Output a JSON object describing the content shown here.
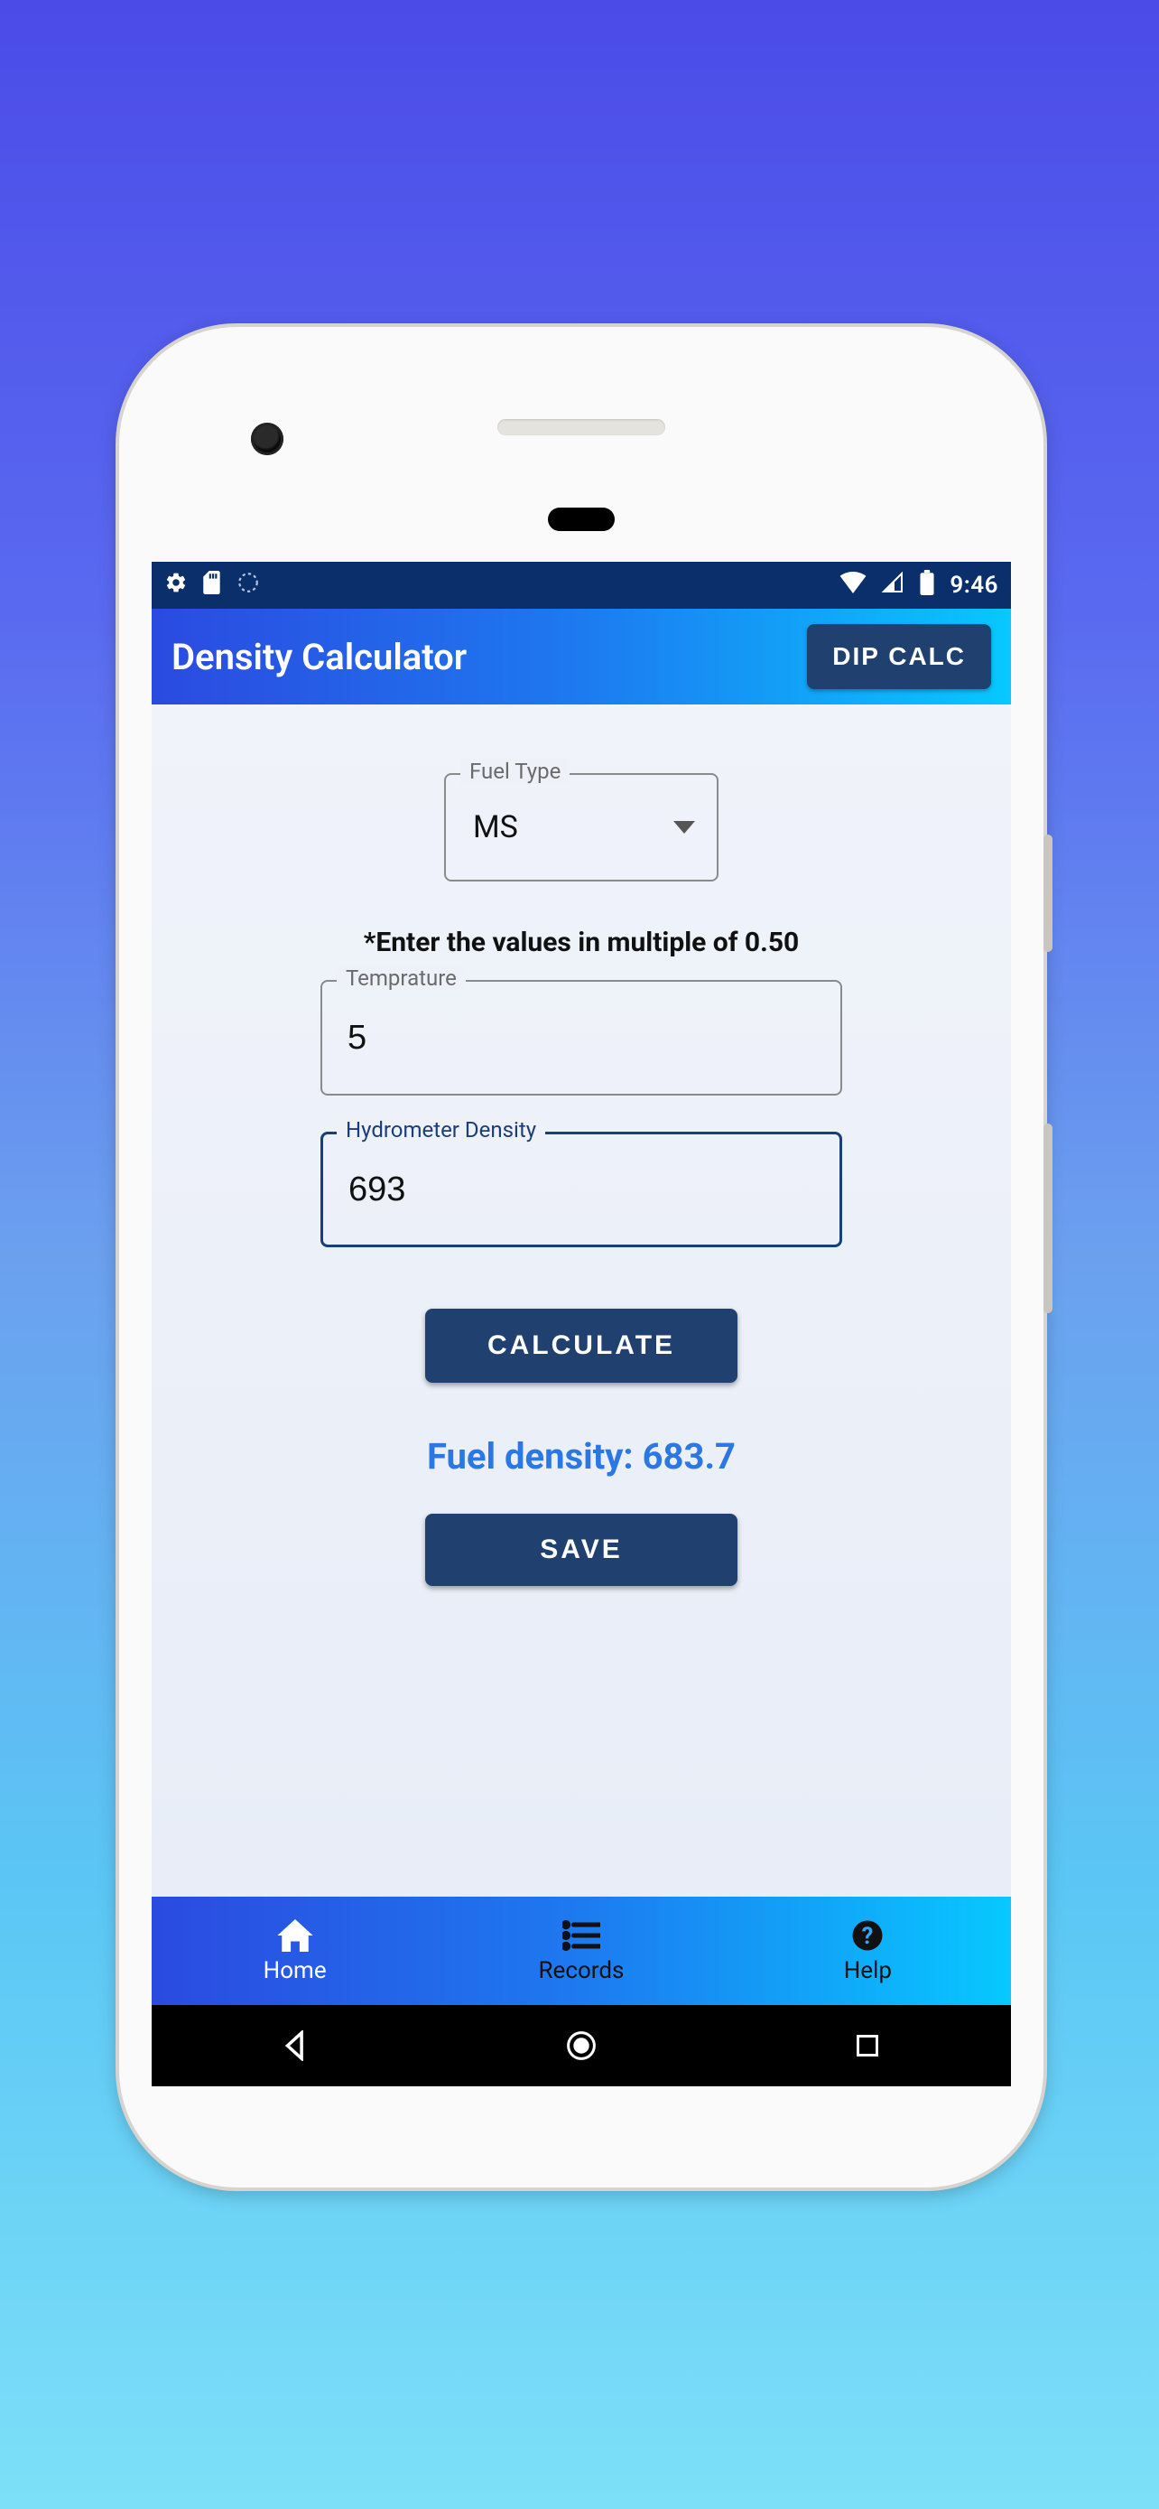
{
  "status": {
    "time": "9:46"
  },
  "appbar": {
    "title": "Density Calculator",
    "dip_btn": "DIP CALC"
  },
  "form": {
    "fuel_label": "Fuel Type",
    "fuel_value": "MS",
    "hint": "*Enter the values in multiple of 0.50",
    "temp_label": "Temprature",
    "temp_value": "5",
    "hyd_label": "Hydrometer Density",
    "hyd_value": "693",
    "calc_btn": "CALCULATE",
    "save_btn": "SAVE"
  },
  "result": {
    "label": "Fuel density: ",
    "value": "683.7"
  },
  "nav": {
    "home": "Home",
    "records": "Records",
    "help": "Help"
  }
}
